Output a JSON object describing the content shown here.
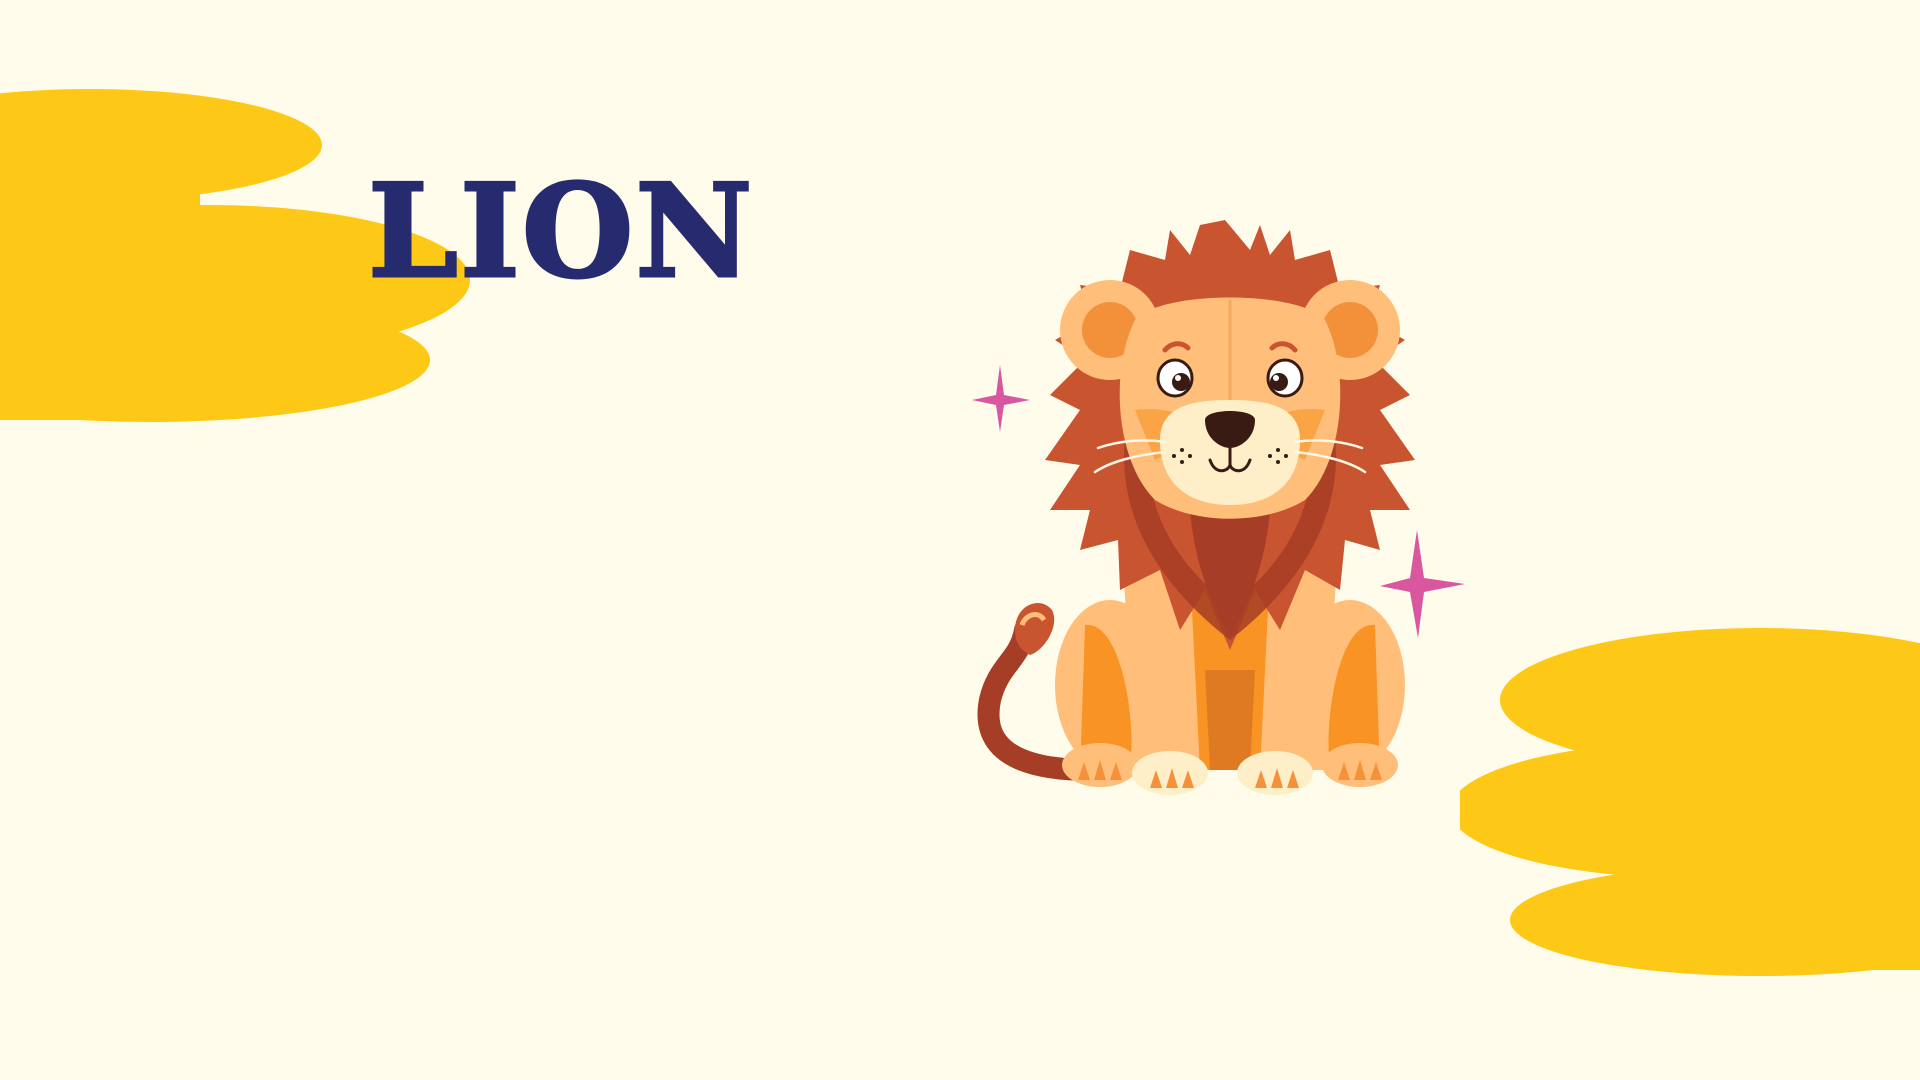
{
  "slide": {
    "title": "LION",
    "colors": {
      "background": "#FFFCEB",
      "cloud": "#FDC816",
      "title": "#262A6E",
      "mane_dark": "#C95430",
      "mane_shadow": "#A63D26",
      "face": "#FFBF7A",
      "body_orange": "#F99323",
      "muzzle": "#FFEFC8",
      "sparkle": "#D9579F"
    },
    "icons": {
      "cloud_top_left": "cloud-shape",
      "cloud_bottom_right": "cloud-shape",
      "illustration": "lion-illustration",
      "sparkle": "sparkle-icon"
    }
  }
}
